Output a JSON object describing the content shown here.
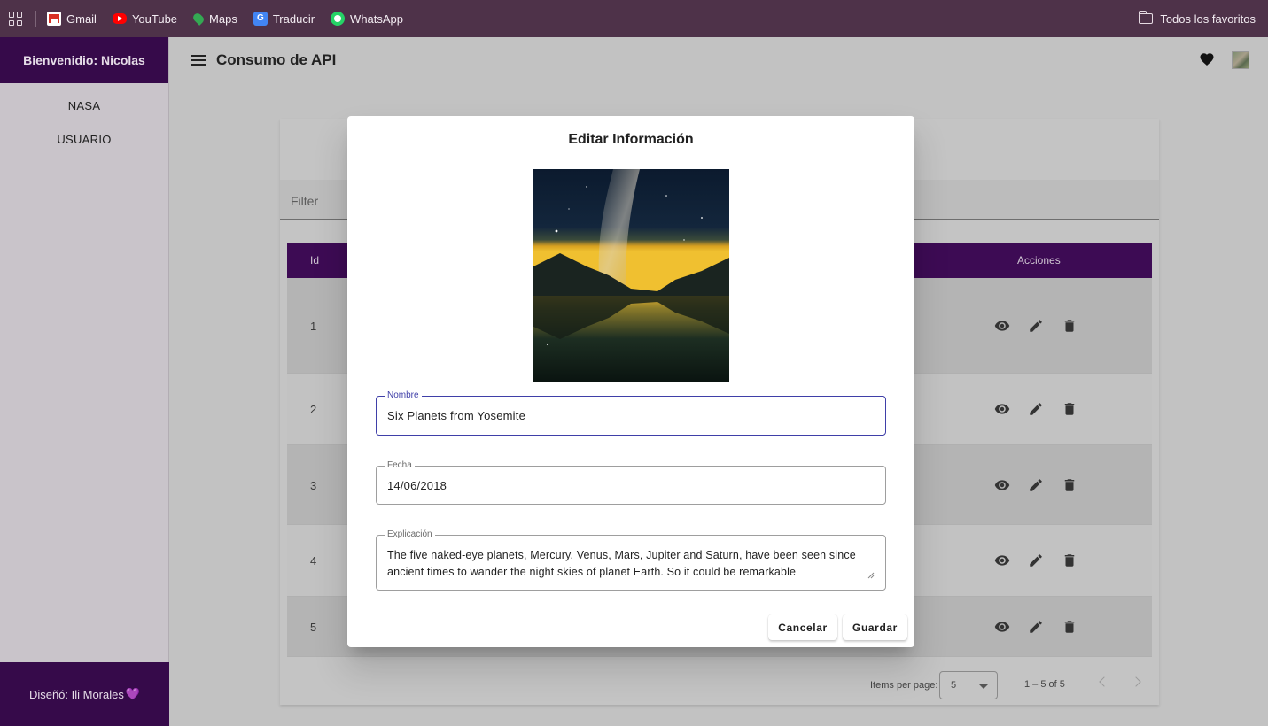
{
  "bookmarks": {
    "items": [
      {
        "label": "Gmail",
        "icon": "gmail-icon"
      },
      {
        "label": "YouTube",
        "icon": "youtube-icon"
      },
      {
        "label": "Maps",
        "icon": "maps-icon"
      },
      {
        "label": "Traducir",
        "icon": "translate-icon"
      },
      {
        "label": "WhatsApp",
        "icon": "whatsapp-icon"
      }
    ],
    "all_favorites": "Todos los favoritos"
  },
  "sidebar": {
    "welcome": "Bienvenidio: Nicolas",
    "items": [
      {
        "label": "NASA"
      },
      {
        "label": "USUARIO"
      }
    ],
    "footer": "Diseñó: Ili Morales",
    "footer_heart": "💜"
  },
  "toolbar": {
    "title": "Consumo de API"
  },
  "filter": {
    "placeholder": "Filter"
  },
  "table": {
    "headers": {
      "id": "Id",
      "actions": "Acciones"
    },
    "rows": [
      {
        "id": "1"
      },
      {
        "id": "2"
      },
      {
        "id": "3"
      },
      {
        "id": "4"
      },
      {
        "id": "5"
      }
    ]
  },
  "paginator": {
    "items_per_page_label": "Items per page:",
    "page_size": "5",
    "range": "1 – 5 of 5"
  },
  "dialog": {
    "title": "Editar Información",
    "fields": {
      "nombre": {
        "label": "Nombre",
        "value": "Six Planets from Yosemite"
      },
      "fecha": {
        "label": "Fecha",
        "value": "14/06/2018"
      },
      "explicacion": {
        "label": "Explicación",
        "value": "The five naked-eye planets, Mercury, Venus, Mars, Jupiter and Saturn, have been seen since ancient times to wander the night skies of planet Earth. So it could be remarkable"
      }
    },
    "buttons": {
      "cancel": "Cancelar",
      "save": "Guardar"
    }
  },
  "colors": {
    "primary": "#5a1080",
    "bookmark_bar": "#4e3249",
    "focused_field": "#3f3fa8"
  }
}
